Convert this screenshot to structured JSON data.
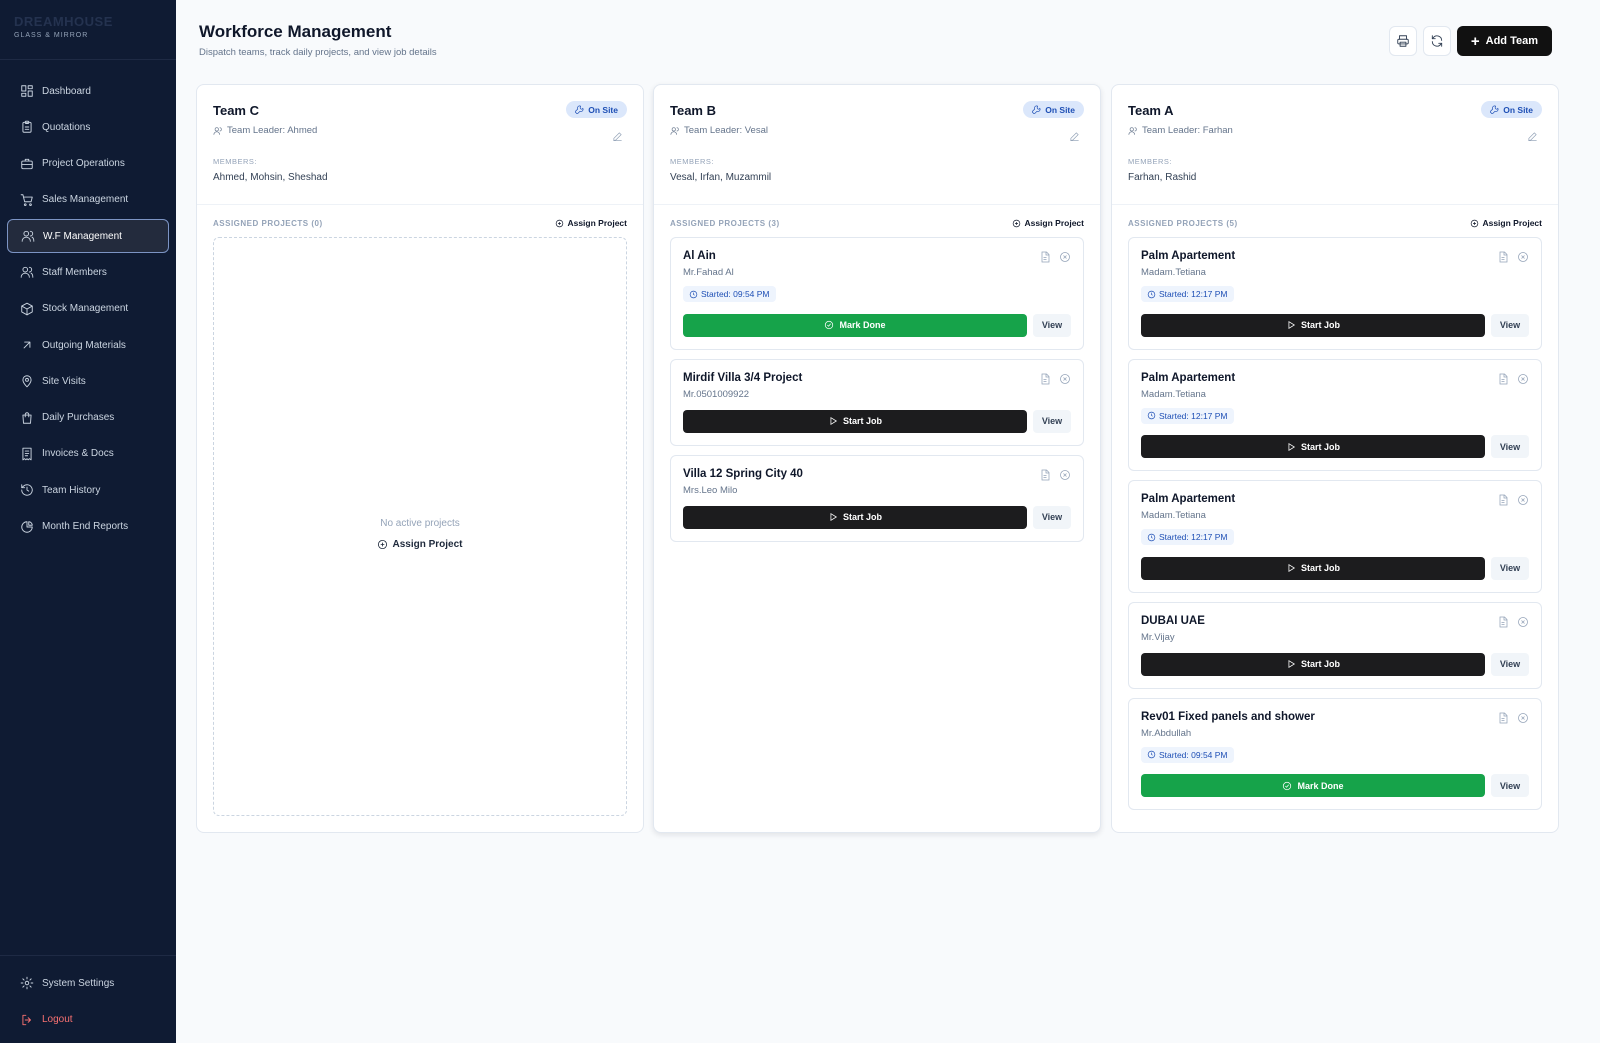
{
  "brand": {
    "name": "DREAMHOUSE",
    "subtitle": "GLASS & MIRROR"
  },
  "sidebar": {
    "items": [
      {
        "label": "Dashboard",
        "icon": "dashboard-icon"
      },
      {
        "label": "Quotations",
        "icon": "clipboard-icon"
      },
      {
        "label": "Project Operations",
        "icon": "briefcase-icon"
      },
      {
        "label": "Sales Management",
        "icon": "cart-icon"
      },
      {
        "label": "W.F Management",
        "icon": "users-icon",
        "active": true
      },
      {
        "label": "Staff Members",
        "icon": "users-icon"
      },
      {
        "label": "Stock Management",
        "icon": "box-icon"
      },
      {
        "label": "Outgoing Materials",
        "icon": "arrow-up-right-icon"
      },
      {
        "label": "Site Visits",
        "icon": "map-pin-icon"
      },
      {
        "label": "Daily Purchases",
        "icon": "shopping-bag-icon"
      },
      {
        "label": "Invoices & Docs",
        "icon": "receipt-icon"
      },
      {
        "label": "Team History",
        "icon": "history-icon"
      },
      {
        "label": "Month End Reports",
        "icon": "pie-chart-icon"
      }
    ],
    "bottom": [
      {
        "label": "System Settings",
        "icon": "gear-icon"
      },
      {
        "label": "Logout",
        "icon": "logout-icon"
      }
    ]
  },
  "header": {
    "title": "Workforce Management",
    "subtitle": "Dispatch teams, track daily projects, and view job details",
    "add_team_label": "Add Team"
  },
  "teams": [
    {
      "name": "Team C",
      "leader": "Team Leader: Ahmed",
      "status": "On Site",
      "members_label": "MEMBERS:",
      "members": "Ahmed, Mohsin, Sheshad",
      "assigned_label": "ASSIGNED PROJECTS (0)",
      "assign_label": "Assign Project",
      "empty_text": "No active projects",
      "empty_assign_label": "Assign Project",
      "projects": []
    },
    {
      "name": "Team B",
      "leader": "Team Leader: Vesal",
      "status": "On Site",
      "members_label": "MEMBERS:",
      "members": "Vesal, Irfan, Muzammil",
      "assigned_label": "ASSIGNED PROJECTS (3)",
      "assign_label": "Assign Project",
      "projects": [
        {
          "name": "Al Ain",
          "client": "Mr.Fahad Al",
          "started": "Started: 09:54 PM",
          "action": "Mark Done",
          "view": "View"
        },
        {
          "name": "Mirdif Villa 3/4 Project",
          "client": "Mr.0501009922",
          "started": "",
          "action": "Start Job",
          "view": "View"
        },
        {
          "name": "Villa 12 Spring City 40",
          "client": "Mrs.Leo Milo",
          "started": "",
          "action": "Start Job",
          "view": "View"
        }
      ]
    },
    {
      "name": "Team A",
      "leader": "Team Leader: Farhan",
      "status": "On Site",
      "members_label": "MEMBERS:",
      "members": "Farhan, Rashid",
      "assigned_label": "ASSIGNED PROJECTS (5)",
      "assign_label": "Assign Project",
      "projects": [
        {
          "name": "Palm Apartement",
          "client": "Madam.Tetiana",
          "started": "Started: 12:17 PM",
          "action": "Start Job",
          "view": "View"
        },
        {
          "name": "Palm Apartement",
          "client": "Madam.Tetiana",
          "started": "Started: 12:17 PM",
          "action": "Start Job",
          "view": "View"
        },
        {
          "name": "Palm Apartement",
          "client": "Madam.Tetiana",
          "started": "Started: 12:17 PM",
          "action": "Start Job",
          "view": "View"
        },
        {
          "name": "DUBAI UAE",
          "client": "Mr.Vijay",
          "started": "",
          "action": "Start Job",
          "view": "View"
        },
        {
          "name": "Rev01 Fixed panels and shower",
          "client": "Mr.Abdullah",
          "started": "Started: 09:54 PM",
          "action": "Mark Done",
          "view": "View"
        }
      ]
    }
  ],
  "colors": {
    "sidebar_bg": "#0f1b33",
    "status_blue": "#1e4fb5",
    "done_green": "#16a34a",
    "dark_button": "#1c1c1e"
  }
}
